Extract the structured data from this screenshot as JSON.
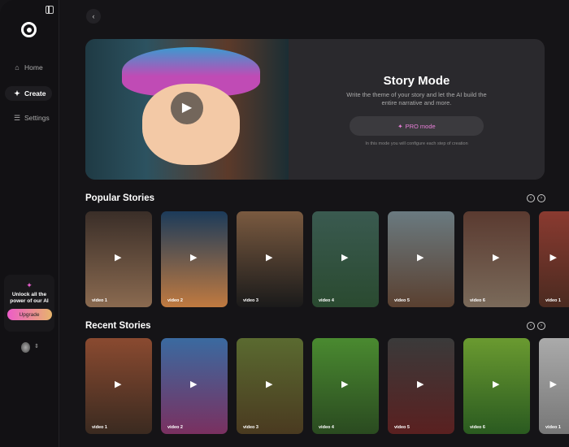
{
  "sidebar": {
    "items": [
      {
        "label": "Home",
        "icon": "home-icon"
      },
      {
        "label": "Create",
        "icon": "sparkles-icon"
      },
      {
        "label": "Settings",
        "icon": "sliders-icon"
      }
    ],
    "promo": {
      "text": "Unlock all the power of our AI",
      "button": "Upgrade"
    }
  },
  "hero": {
    "title": "Story Mode",
    "description": "Write the theme of your story and let the AI build the entire narrative and more.",
    "button": "PRO mode",
    "note": "In this mode you will configure each step of creation"
  },
  "popular": {
    "title": "Popular Stories",
    "cards": [
      "video 1",
      "video 2",
      "video 3",
      "video 4",
      "video 5",
      "video 6",
      "video 1"
    ]
  },
  "recent": {
    "title": "Recent Stories",
    "cards": [
      "video 1",
      "video 2",
      "video 3",
      "video 4",
      "video 5",
      "video 6",
      "video 1"
    ]
  },
  "colors": {
    "accent_start": "#ec5cc8",
    "accent_end": "#e8b46c"
  }
}
